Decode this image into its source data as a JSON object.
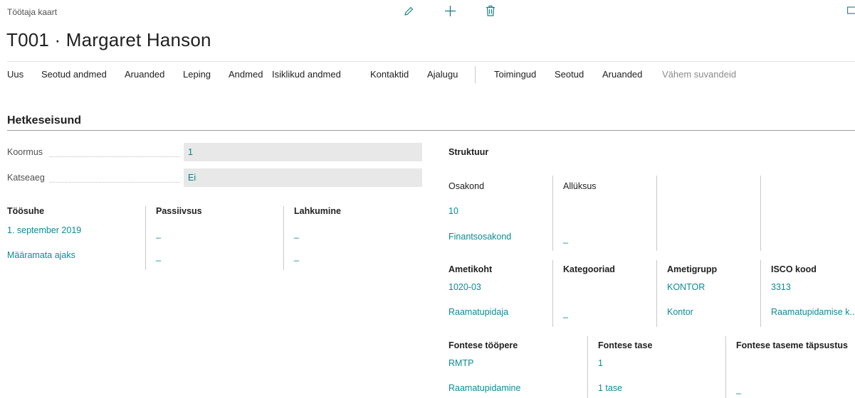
{
  "header": {
    "caption": "Töötaja kaart",
    "title": "T001 · Margaret Hanson"
  },
  "icons": {
    "edit": "pencil-icon",
    "add": "plus-icon",
    "delete": "trash-icon",
    "expand": "window-icon"
  },
  "actions": [
    "Uus",
    "Seotud andmed",
    "Aruanded",
    "Leping",
    "Andmed",
    "Isiklikud andmed",
    "Kontaktid",
    "Ajalugu"
  ],
  "actions2": [
    "Toimingud",
    "Seotud",
    "Aruanded"
  ],
  "fewer_options": "Vähem suvandeid",
  "section": {
    "title": "Hetkeseisund"
  },
  "fields": {
    "koormus": {
      "label": "Koormus",
      "value": "1"
    },
    "katseaeg": {
      "label": "Katseaeg",
      "value": "Ei"
    }
  },
  "tooshue": {
    "title": "Töösuhe",
    "start": "1. september 2019",
    "type": "Määramata ajaks"
  },
  "passiivsus": {
    "title": "Passiivsus",
    "v1": "_",
    "v2": "_"
  },
  "lahkumine": {
    "title": "Lahkumine",
    "v1": "_",
    "v2": "_"
  },
  "struktuur": {
    "title": "Struktuur",
    "osakond_label": "Osakond",
    "osakond_code": "10",
    "osakond_name": "Finantsosakond",
    "allyksus_label": "Allüksus",
    "allyksus_value": "_"
  },
  "ametikoht": {
    "title": "Ametikoht",
    "code": "1020-03",
    "name": "Raamatupidaja",
    "kategooriad_title": "Kategooriad",
    "kategooriad_value": "_",
    "ametigrupp_title": "Ametigrupp",
    "ametigrupp_code": "KONTOR",
    "ametigrupp_name": "Kontor",
    "isco_title": "ISCO kood",
    "isco_code": "3313",
    "isco_name": "Raamatupidamise k..."
  },
  "fontes": {
    "tooppere_title": "Fontese tööpere",
    "tooppere_code": "RMTP",
    "tooppere_name": "Raamatupidamine",
    "tase_title": "Fontese tase",
    "tase_code": "1",
    "tase_name": "1 tase",
    "tapsustus_title": "Fontese taseme täpsustus",
    "tapsustus_value": "_"
  }
}
